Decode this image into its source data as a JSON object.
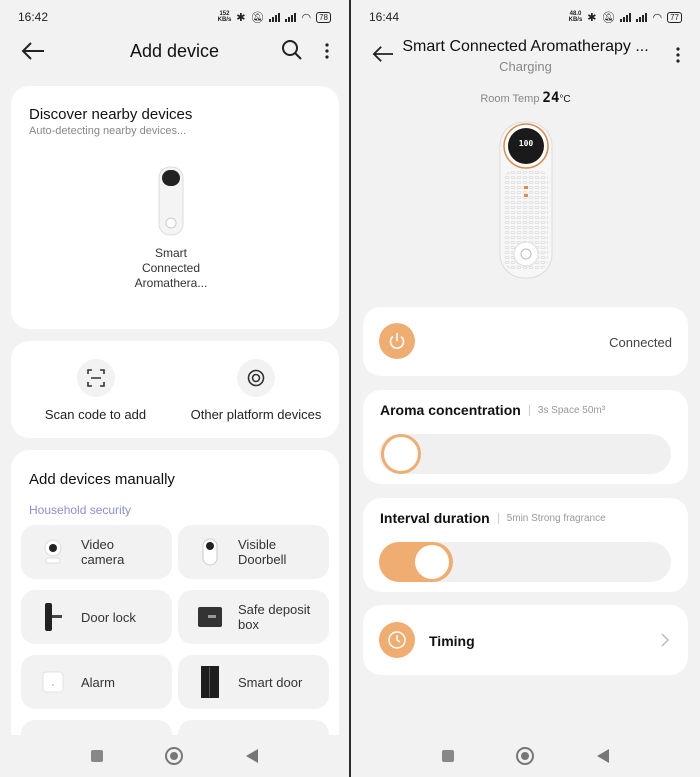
{
  "left": {
    "status": {
      "time": "16:42",
      "net_top": "152",
      "net_bottom": "KB/s",
      "battery": "78"
    },
    "title": "Add device",
    "discover": {
      "title": "Discover nearby devices",
      "subtitle": "Auto-detecting nearby devices...",
      "device_name": "Smart Connected Aromathera..."
    },
    "actions": {
      "scan": "Scan code to add",
      "other": "Other platform devices"
    },
    "manual": {
      "title": "Add devices manually",
      "category": "Household security",
      "tiles": [
        {
          "label": "Video camera",
          "icon": "camera-icon"
        },
        {
          "label": "Visible Doorbell",
          "icon": "doorbell-icon"
        },
        {
          "label": "Door lock",
          "icon": "door-lock-icon"
        },
        {
          "label": "Safe deposit box",
          "icon": "safe-box-icon"
        },
        {
          "label": "Alarm",
          "icon": "alarm-icon"
        },
        {
          "label": "Smart door",
          "icon": "smart-door-icon"
        }
      ]
    }
  },
  "right": {
    "status": {
      "time": "16:44",
      "net_top": "48.0",
      "net_bottom": "KB/s",
      "battery": "77"
    },
    "title": "Smart Connected Aromatherapy ...",
    "subtitle": "Charging",
    "room_temp_label": "Room Temp",
    "room_temp_value": "24",
    "room_temp_unit": "°C",
    "device_display": "100",
    "power": {
      "status": "Connected"
    },
    "aroma": {
      "title": "Aroma concentration",
      "detail": "3s Space 50m³",
      "value": 0
    },
    "interval": {
      "title": "Interval duration",
      "detail": "5min Strong fragrance",
      "on": true
    },
    "timing": {
      "title": "Timing"
    }
  },
  "colors": {
    "accent": "#f0ad72",
    "background": "#f2f2f2",
    "category": "#8a8fd6"
  }
}
